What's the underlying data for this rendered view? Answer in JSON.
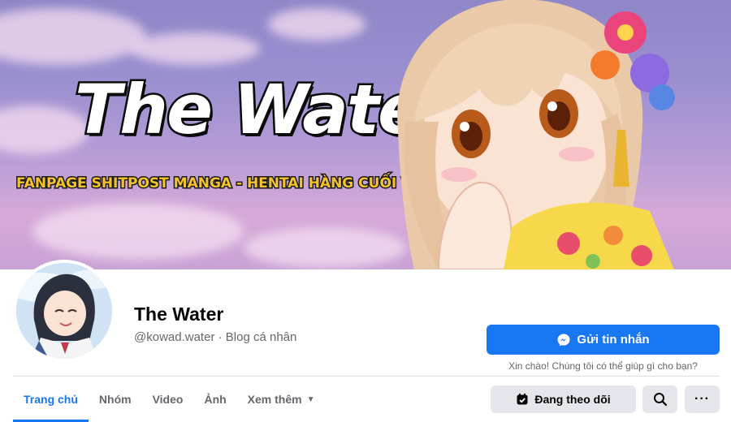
{
  "cover": {
    "title": "The Water",
    "subtitle": "FANPAGE SHITPOST MANGA - HENTAI HÀNG CUỐI VIỆT NAM"
  },
  "profile": {
    "name": "The Water",
    "handle": "@kowad.water",
    "separator": " · ",
    "category": "Blog cá nhân"
  },
  "actions": {
    "message_label": "Gửi tin nhắn",
    "greeting": "Xin chào! Chúng tôi có thể giúp gì cho bạn?",
    "following_label": "Đang theo dõi",
    "more_label": "···"
  },
  "tabs": [
    {
      "label": "Trang chủ",
      "active": true
    },
    {
      "label": "Nhóm"
    },
    {
      "label": "Video"
    },
    {
      "label": "Ảnh"
    },
    {
      "label": "Xem thêm",
      "dropdown": true
    }
  ],
  "icons": {
    "messenger": "messenger-icon",
    "following": "following-icon",
    "search": "search-icon",
    "more": "more-icon",
    "caret": "caret-down-icon"
  },
  "colors": {
    "accent": "#1877f2",
    "button_gray": "#e4e6eb",
    "secondary_text": "#65676b"
  }
}
